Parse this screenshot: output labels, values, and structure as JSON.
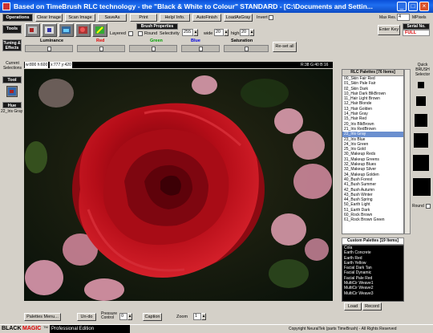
{
  "window": {
    "title": "Based on TimeBrush RLC technology - the \"Black & White to Colour\" STANDARD - [C:\\Documents and Settin..."
  },
  "row1": {
    "operations": "Operations",
    "clear_image": "Clear Image",
    "scan_image": "Scan Image",
    "save_as": "SaveAs",
    "print": "Print",
    "help_info": "Help/ Info.",
    "autofinish": "AutoFinish",
    "load_as_gray": "LoadAsGray",
    "invert": "Invert",
    "max_res_label": "Max Res.",
    "max_res_value": "4",
    "mpixels": "MPixels"
  },
  "row2": {
    "tools": "Tools",
    "brush_properties": "Brush Properties",
    "layered": "Layered",
    "round": "Round",
    "selectivity": "Selectivity",
    "selectivity_value": "255",
    "wide_label": "wide",
    "wide_value": "20",
    "high_label": "high",
    "high_value": "20",
    "enter_key": "Enter Key",
    "serial_label": "Serial No.",
    "serial_value": "FULL"
  },
  "row3": {
    "tuning_effects": "Tuning & Effects",
    "luminance": "Luminance",
    "red": "Red",
    "green": "Green",
    "blue": "Blue",
    "saturation": "Saturation",
    "reset_all": "Re-set all",
    "red_color": "#e00000",
    "green_color": "#00a000",
    "blue_color": "#0000e0"
  },
  "leftpanel": {
    "current_selections": "Current Selections",
    "tool": "Tool",
    "hue": "Hue",
    "hue_value": "22_Iris Gray"
  },
  "imagebar": {
    "dims": "w:800 h:600",
    "coords": "x:777 y:420",
    "rgb": "R:38 G:40 B:16"
  },
  "palettes": {
    "header": "RLC Palettes [76 Items]",
    "items": [
      "00_Skin Fair Red",
      "01_Skin Pale Fair",
      "02_Skin Dark",
      "10_Hair Dark BlkBrown",
      "11_Hair Light Brown",
      "12_Hair Blonde",
      "13_Hair Golden",
      "14_Hair Gray",
      "15_Hair Red",
      "20_Iris BlkBrown",
      "21_Iris RedBrown",
      "22_Iris Gray",
      "23_Iris Blue",
      "24_Iris Green",
      "25_Iris Gold",
      "30_Makeup Reds",
      "31_Makeup Greens",
      "32_Makeup Blues",
      "33_Makeup Silver",
      "34_Makeup Golden",
      "40_Bush Forest",
      "41_Bush Summer",
      "42_Bush Autumn",
      "43_Bush Winter",
      "44_Bush Spring",
      "50_Earth Light",
      "51_Earth Dark",
      "60_Rock Brown",
      "61_Rock Brown Green"
    ],
    "selected_index": 11
  },
  "custom": {
    "header": "Custom Palettes [19 Items]",
    "items": [
      "Cola",
      "Earth Concrete",
      "Earth Red",
      "Earth Yellow",
      "Facial Dark Tan",
      "Facial Dynamic",
      "Facial Pale Red",
      "MultiCir Weave1",
      "MultiCir Weave2",
      "MultiCir Weave3"
    ],
    "load": "Load",
    "record": "Record"
  },
  "quickbrush": {
    "label": "Quick BRUSH Selector",
    "round": "Round"
  },
  "bottom": {
    "palettes_menu": "Palettes Menu...",
    "undo": "Un-do",
    "pressure_control": "Pressure Control",
    "pressure_value": "0",
    "caption": "Caption",
    "zoom": "Zoom",
    "zoom_value": "1"
  },
  "status": {
    "brand_black": "BLACK",
    "brand_magic": "MAGIC",
    "tm": "TM",
    "edition": "Professional Edition",
    "copyright": "Copyright NeuralTek (parts TimeBrush) - All Rights Reserved"
  }
}
